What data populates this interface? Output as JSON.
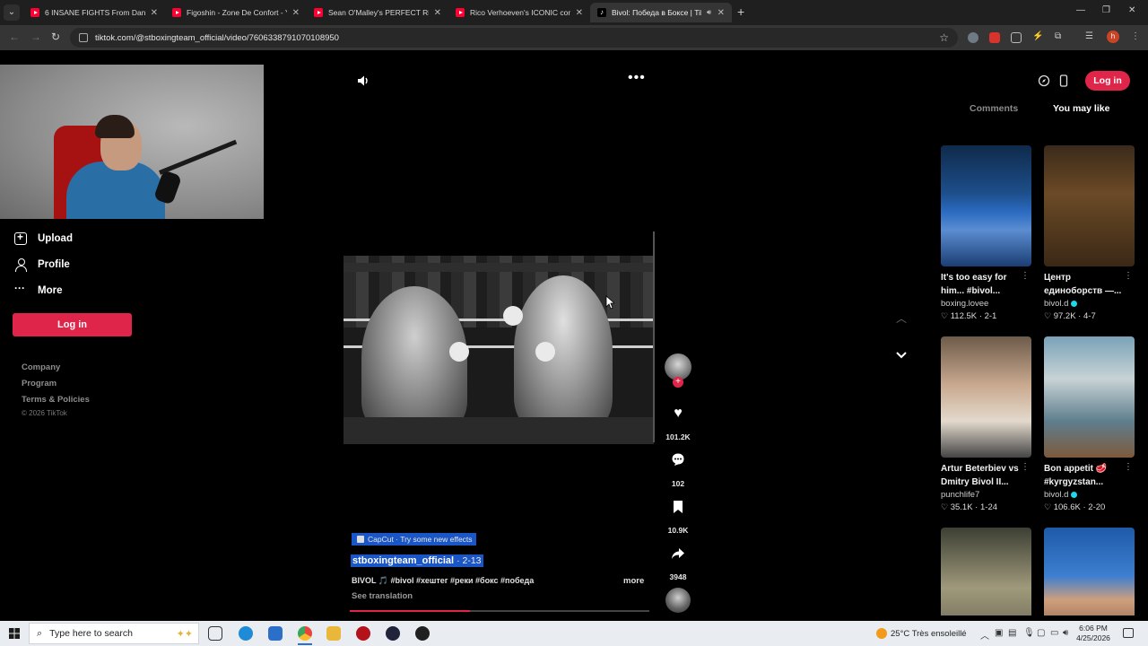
{
  "browser": {
    "tabs": [
      {
        "title": "6 INSANE FIGHTS From Dana White",
        "favicon": "youtube-icon"
      },
      {
        "title": "Figoshin - Zone De Confort - YouTube",
        "favicon": "youtube-icon"
      },
      {
        "title": "Sean O'Malley's PERFECT Right Hand",
        "favicon": "youtube-icon"
      },
      {
        "title": "Rico Verhoeven's ICONIC comeback",
        "favicon": "youtube-icon"
      },
      {
        "title": "Bivol: Победа в Боксе | TikTok",
        "favicon": "tiktok-icon",
        "active": true
      }
    ],
    "url": "tiktok.com/@stboxingteam_official/video/7606338791070108950",
    "profile_initial": "h"
  },
  "sidebar": {
    "items": [
      {
        "label": "Upload",
        "icon": "upload-icon"
      },
      {
        "label": "Profile",
        "icon": "profile-icon"
      },
      {
        "label": "More",
        "icon": "more-icon"
      }
    ],
    "login_label": "Log in",
    "footer_links": [
      "Company",
      "Program",
      "Terms & Policies"
    ],
    "copyright": "© 2026 TikTok"
  },
  "video": {
    "effect_label": "CapCut · Try some new effects",
    "author": "stboxingteam_official",
    "date": "· 2-13",
    "caption": "BIVOL 🎵 #bivol #хештег #реки #бокс #победа",
    "more_label": "more",
    "see_translation": "See translation",
    "progress": 0.4,
    "likes": "101.2K",
    "comments": "102",
    "saves": "10.9K",
    "shares": "3948"
  },
  "top_right": {
    "login_label": "Log in"
  },
  "right_panel": {
    "tabs": [
      {
        "label": "Comments",
        "active": false
      },
      {
        "label": "You may like",
        "active": true
      }
    ],
    "cards": [
      {
        "title": "It's too easy for him... #bivol...",
        "author": "boxing.lovee",
        "verified": false,
        "likes": "112.5K",
        "date": "2-1",
        "thumb": "ring"
      },
      {
        "title": "Центр единоборств —...",
        "author": "bivol.d",
        "verified": true,
        "likes": "97.2K",
        "date": "4-7",
        "thumb": "office"
      },
      {
        "title": "Artur Beterbiev vs Dmitry Bivol II...",
        "author": "punchlife7",
        "verified": false,
        "likes": "35.1K",
        "date": "1-24",
        "thumb": "faceoff"
      },
      {
        "title": "Bon appetit 🥩 #kyrgyzstan...",
        "author": "bivol.d",
        "verified": true,
        "likes": "106.6K",
        "date": "2-20",
        "thumb": "craft"
      },
      {
        "title": "",
        "author": "",
        "verified": false,
        "likes": "",
        "date": "",
        "thumb": "fight"
      },
      {
        "title": "",
        "author": "",
        "verified": false,
        "likes": "",
        "date": "",
        "thumb": "smile"
      }
    ]
  },
  "taskbar": {
    "search_placeholder": "Type here to search",
    "weather": "25°C  Très ensoleillé",
    "time": "6:06 PM",
    "date": "4/25/2026"
  },
  "colors": {
    "tiktok_red": "#e0254a",
    "highlight_blue": "#1a56c6",
    "verified": "#20d5ec"
  }
}
